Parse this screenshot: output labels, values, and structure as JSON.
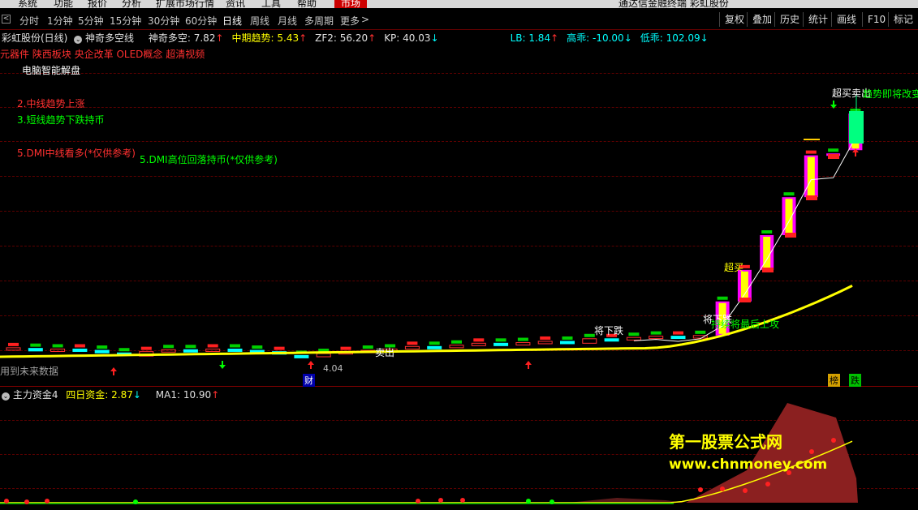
{
  "menubar": {
    "items": [
      "系统",
      "功能",
      "报价",
      "分析",
      "扩展市场行情",
      "资讯",
      "工具",
      "帮助"
    ],
    "active": "市场",
    "window_title": "通达信金融终端 彩虹股份"
  },
  "periodbar": {
    "periods": [
      "分时",
      "1分钟",
      "5分钟",
      "15分钟",
      "30分钟",
      "60分钟",
      "日线",
      "周线",
      "月线",
      "多周期",
      "更多"
    ],
    "selected": "日线",
    "right_buttons": [
      "复权",
      "叠加",
      "历史",
      "统计",
      "画线",
      "F10",
      "标记"
    ]
  },
  "main_header": {
    "stock": "彩虹股份(日线)",
    "indicator": "神奇多空线",
    "values": [
      {
        "label": "神奇多空: 7.82",
        "arrow": "↑",
        "color": "#e0e0e0",
        "arrow_color": "#ff3030"
      },
      {
        "label": "中期趋势: 5.43",
        "arrow": "↑",
        "color": "#ffff00",
        "arrow_color": "#ff3030"
      },
      {
        "label": "ZF2: 56.20",
        "arrow": "↑",
        "color": "#e0e0e0",
        "arrow_color": "#ff3030"
      },
      {
        "label": "KP: 40.03",
        "arrow": "↓",
        "color": "#e0e0e0",
        "arrow_color": "#00ffff"
      },
      {
        "label": "LB: 1.84",
        "arrow": "↑",
        "color": "#00ffff",
        "arrow_color": "#ff3030"
      },
      {
        "label": "高乖: -10.00",
        "arrow": "↓",
        "color": "#00ffff",
        "arrow_color": "#00ffff"
      },
      {
        "label": "低乖: 102.09",
        "arrow": "↓",
        "color": "#00ffff",
        "arrow_color": "#00ffff"
      }
    ]
  },
  "concepts": "元器件 陕西板块 央企改革 OLED概念 超清视频",
  "analysis": {
    "title": "电脑智能解盘",
    "line2": "2.中线趋势上涨",
    "line3": "3.短线趋势下跌持币",
    "line5a": "5.DMI中线看多(*仅供参考)",
    "line5b": "5.DMI高位回落持币(*仅供参考)"
  },
  "signals": {
    "sell": "卖出",
    "will_fall": "将下跌",
    "will_fall2": "将下跌",
    "last_attack": "持续将最后上攻",
    "overbought": "超买",
    "overbought_top": "超买卖出",
    "trend_change": "趋势即将改变",
    "low_price": "4.04",
    "cai": "财",
    "no_future": "用到未来数据",
    "bang": "榜",
    "die": "跌"
  },
  "sub_header": {
    "indicator": "主力资金4",
    "v1": "四日资金: 2.87",
    "v1_arrow": "↓",
    "v2": "MA1: 10.90",
    "v2_arrow": "↑"
  },
  "watermark": {
    "line1": "第一股票公式网",
    "line2": "www.chnmoney.com"
  },
  "colors": {
    "up": "#ff3030",
    "down": "#00ffff",
    "yellow": "#ffff00",
    "green": "#00ff00",
    "magenta": "#ff00ff",
    "fund": "#8b2020"
  },
  "chart_data": {
    "type": "candlestick",
    "candles": [
      {
        "o": 4.15,
        "c": 4.18
      },
      {
        "o": 4.17,
        "c": 4.13
      },
      {
        "o": 4.13,
        "c": 4.16
      },
      {
        "o": 4.16,
        "c": 4.14
      },
      {
        "o": 4.14,
        "c": 4.1
      },
      {
        "o": 4.1,
        "c": 4.08
      },
      {
        "o": 4.05,
        "c": 4.12
      },
      {
        "o": 4.12,
        "c": 4.15
      },
      {
        "o": 4.15,
        "c": 4.13
      },
      {
        "o": 4.13,
        "c": 4.16
      },
      {
        "o": 4.16,
        "c": 4.14
      },
      {
        "o": 4.14,
        "c": 4.12
      },
      {
        "o": 4.12,
        "c": 4.08
      },
      {
        "o": 4.06,
        "c": 4.04
      },
      {
        "o": 4.04,
        "c": 4.09
      },
      {
        "o": 4.09,
        "c": 4.12
      },
      {
        "o": 4.12,
        "c": 4.14
      },
      {
        "o": 4.14,
        "c": 4.16
      },
      {
        "o": 4.16,
        "c": 4.2
      },
      {
        "o": 4.2,
        "c": 4.18
      },
      {
        "o": 4.18,
        "c": 4.22
      },
      {
        "o": 4.22,
        "c": 4.25
      },
      {
        "o": 4.25,
        "c": 4.23
      },
      {
        "o": 4.23,
        "c": 4.26
      },
      {
        "o": 4.26,
        "c": 4.28
      },
      {
        "o": 4.28,
        "c": 4.25
      },
      {
        "o": 4.25,
        "c": 4.32
      },
      {
        "o": 4.32,
        "c": 4.3
      },
      {
        "o": 4.3,
        "c": 4.34
      },
      {
        "o": 4.34,
        "c": 4.36
      },
      {
        "o": 4.36,
        "c": 4.33
      },
      {
        "o": 4.33,
        "c": 4.37
      },
      {
        "o": 4.37,
        "c": 4.9
      },
      {
        "o": 4.9,
        "c": 5.39
      },
      {
        "o": 5.39,
        "c": 5.93
      },
      {
        "o": 5.93,
        "c": 6.52
      },
      {
        "o": 6.52,
        "c": 7.17
      },
      {
        "o": 7.17,
        "c": 7.2
      },
      {
        "o": 7.25,
        "c": 7.82
      }
    ]
  }
}
